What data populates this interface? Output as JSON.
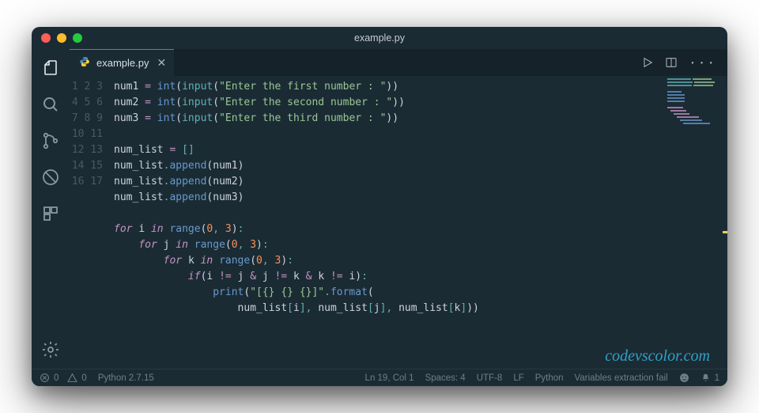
{
  "window": {
    "title": "example.py"
  },
  "tab": {
    "label": "example.py"
  },
  "gutter_start": 1,
  "gutter_end": 17,
  "code_lines": [
    [
      [
        "var",
        "num1"
      ],
      [
        "plain",
        " "
      ],
      [
        "op",
        "="
      ],
      [
        "plain",
        " "
      ],
      [
        "builtin",
        "int"
      ],
      [
        "paren",
        "("
      ],
      [
        "call",
        "input"
      ],
      [
        "paren",
        "("
      ],
      [
        "str",
        "\"Enter the first number : \""
      ],
      [
        "paren",
        ")"
      ],
      [
        "paren",
        ")"
      ]
    ],
    [
      [
        "var",
        "num2"
      ],
      [
        "plain",
        " "
      ],
      [
        "op",
        "="
      ],
      [
        "plain",
        " "
      ],
      [
        "builtin",
        "int"
      ],
      [
        "paren",
        "("
      ],
      [
        "call",
        "input"
      ],
      [
        "paren",
        "("
      ],
      [
        "str",
        "\"Enter the second number : \""
      ],
      [
        "paren",
        ")"
      ],
      [
        "paren",
        ")"
      ]
    ],
    [
      [
        "var",
        "num3"
      ],
      [
        "plain",
        " "
      ],
      [
        "op",
        "="
      ],
      [
        "plain",
        " "
      ],
      [
        "builtin",
        "int"
      ],
      [
        "paren",
        "("
      ],
      [
        "call",
        "input"
      ],
      [
        "paren",
        "("
      ],
      [
        "str",
        "\"Enter the third number : \""
      ],
      [
        "paren",
        ")"
      ],
      [
        "paren",
        ")"
      ]
    ],
    [],
    [
      [
        "var",
        "num_list"
      ],
      [
        "plain",
        " "
      ],
      [
        "op",
        "="
      ],
      [
        "plain",
        " "
      ],
      [
        "punct",
        "["
      ],
      [
        "punct",
        "]"
      ]
    ],
    [
      [
        "var",
        "num_list"
      ],
      [
        "punct",
        "."
      ],
      [
        "prop",
        "append"
      ],
      [
        "paren",
        "("
      ],
      [
        "var",
        "num1"
      ],
      [
        "paren",
        ")"
      ]
    ],
    [
      [
        "var",
        "num_list"
      ],
      [
        "punct",
        "."
      ],
      [
        "prop",
        "append"
      ],
      [
        "paren",
        "("
      ],
      [
        "var",
        "num2"
      ],
      [
        "paren",
        ")"
      ]
    ],
    [
      [
        "var",
        "num_list"
      ],
      [
        "punct",
        "."
      ],
      [
        "prop",
        "append"
      ],
      [
        "paren",
        "("
      ],
      [
        "var",
        "num3"
      ],
      [
        "paren",
        ")"
      ]
    ],
    [],
    [
      [
        "kw",
        "for"
      ],
      [
        "plain",
        " "
      ],
      [
        "var",
        "i"
      ],
      [
        "plain",
        " "
      ],
      [
        "kw",
        "in"
      ],
      [
        "plain",
        " "
      ],
      [
        "builtin",
        "range"
      ],
      [
        "paren",
        "("
      ],
      [
        "num",
        "0"
      ],
      [
        "punct",
        ","
      ],
      [
        "plain",
        " "
      ],
      [
        "num",
        "3"
      ],
      [
        "paren",
        ")"
      ],
      [
        "punct",
        ":"
      ]
    ],
    [
      [
        "plain",
        "    "
      ],
      [
        "kw",
        "for"
      ],
      [
        "plain",
        " "
      ],
      [
        "var",
        "j"
      ],
      [
        "plain",
        " "
      ],
      [
        "kw",
        "in"
      ],
      [
        "plain",
        " "
      ],
      [
        "builtin",
        "range"
      ],
      [
        "paren",
        "("
      ],
      [
        "num",
        "0"
      ],
      [
        "punct",
        ","
      ],
      [
        "plain",
        " "
      ],
      [
        "num",
        "3"
      ],
      [
        "paren",
        ")"
      ],
      [
        "punct",
        ":"
      ]
    ],
    [
      [
        "plain",
        "        "
      ],
      [
        "kw",
        "for"
      ],
      [
        "plain",
        " "
      ],
      [
        "var",
        "k"
      ],
      [
        "plain",
        " "
      ],
      [
        "kw",
        "in"
      ],
      [
        "plain",
        " "
      ],
      [
        "builtin",
        "range"
      ],
      [
        "paren",
        "("
      ],
      [
        "num",
        "0"
      ],
      [
        "punct",
        ","
      ],
      [
        "plain",
        " "
      ],
      [
        "num",
        "3"
      ],
      [
        "paren",
        ")"
      ],
      [
        "punct",
        ":"
      ]
    ],
    [
      [
        "plain",
        "            "
      ],
      [
        "kw",
        "if"
      ],
      [
        "paren",
        "("
      ],
      [
        "var",
        "i"
      ],
      [
        "plain",
        " "
      ],
      [
        "op",
        "!="
      ],
      [
        "plain",
        " "
      ],
      [
        "var",
        "j"
      ],
      [
        "plain",
        " "
      ],
      [
        "op",
        "&"
      ],
      [
        "plain",
        " "
      ],
      [
        "var",
        "j"
      ],
      [
        "plain",
        " "
      ],
      [
        "op",
        "!="
      ],
      [
        "plain",
        " "
      ],
      [
        "var",
        "k"
      ],
      [
        "plain",
        " "
      ],
      [
        "op",
        "&"
      ],
      [
        "plain",
        " "
      ],
      [
        "var",
        "k"
      ],
      [
        "plain",
        " "
      ],
      [
        "op",
        "!="
      ],
      [
        "plain",
        " "
      ],
      [
        "var",
        "i"
      ],
      [
        "paren",
        ")"
      ],
      [
        "punct",
        ":"
      ]
    ],
    [
      [
        "plain",
        "                "
      ],
      [
        "builtin",
        "print"
      ],
      [
        "paren",
        "("
      ],
      [
        "str",
        "\"[{} {} {}]\""
      ],
      [
        "punct",
        "."
      ],
      [
        "prop",
        "format"
      ],
      [
        "paren",
        "("
      ]
    ],
    [
      [
        "plain",
        "                    "
      ],
      [
        "var",
        "num_list"
      ],
      [
        "punct",
        "["
      ],
      [
        "var",
        "i"
      ],
      [
        "punct",
        "]"
      ],
      [
        "punct",
        ","
      ],
      [
        "plain",
        " "
      ],
      [
        "var",
        "num_list"
      ],
      [
        "punct",
        "["
      ],
      [
        "var",
        "j"
      ],
      [
        "punct",
        "]"
      ],
      [
        "punct",
        ","
      ],
      [
        "plain",
        " "
      ],
      [
        "var",
        "num_list"
      ],
      [
        "punct",
        "["
      ],
      [
        "var",
        "k"
      ],
      [
        "punct",
        "]"
      ],
      [
        "paren",
        ")"
      ],
      [
        "paren",
        ")"
      ]
    ],
    [],
    []
  ],
  "status": {
    "errors": "0",
    "warnings": "0",
    "python_version": "Python 2.7.15",
    "cursor": "Ln 19, Col 1",
    "spaces": "Spaces: 4",
    "encoding": "UTF-8",
    "eol": "LF",
    "language": "Python",
    "extra": "Variables extraction fail",
    "bell": "1"
  },
  "watermark": "codevscolor.com"
}
